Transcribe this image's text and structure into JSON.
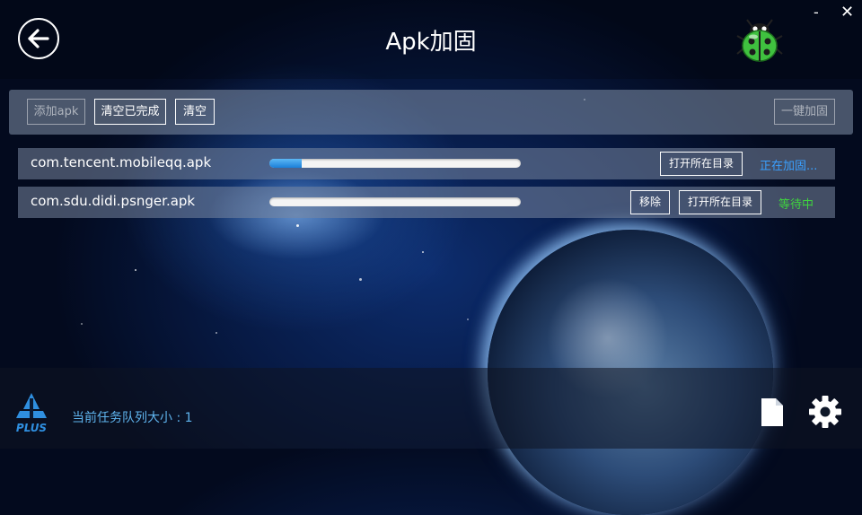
{
  "header": {
    "title": "Apk加固",
    "minimize": "-",
    "close": "✕"
  },
  "toolbar": {
    "add_apk": "添加apk",
    "clear_completed": "清空已完成",
    "clear": "清空",
    "one_click_harden": "一键加固"
  },
  "tasks": [
    {
      "filename": "com.tencent.mobileqq.apk",
      "progress": 0.13,
      "open_dir_label": "打开所在目录",
      "status": "正在加固...",
      "status_color": "#3aa0ff"
    },
    {
      "filename": "com.sdu.didi.psnger.apk",
      "progress": 0.0,
      "remove_label": "移除",
      "open_dir_label": "打开所在目录",
      "status": "等待中",
      "status_color": "#3fd43f"
    }
  ],
  "footer": {
    "logo_text": "PLUS",
    "queue_label": "当前任务队列大小 : 1"
  },
  "icons": {
    "back": "back-arrow-icon",
    "ladybug": "ladybug-icon",
    "document": "document-icon",
    "settings": "gear-icon"
  }
}
